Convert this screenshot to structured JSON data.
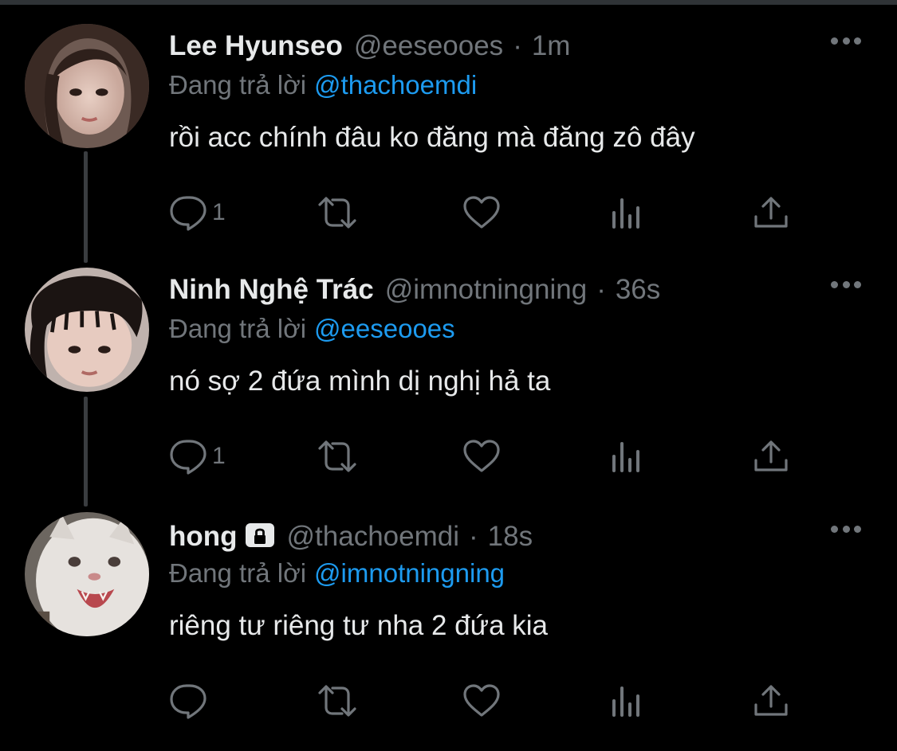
{
  "colors": {
    "background": "#000000",
    "primary_text": "#e7e9ea",
    "secondary_text": "#71767b",
    "mention": "#1d9bf0",
    "thread_line": "#3a3d40"
  },
  "tweets": [
    {
      "display_name": "Lee Hyunseo",
      "protected": false,
      "handle": "@eeseooes",
      "separator": "·",
      "time": "1m",
      "replying_label": "Đang trả lời",
      "replying_to": "@thachoemdi",
      "text": "rồi acc chính đâu ko đăng mà đăng zô đây",
      "reply_count": "1",
      "icons": [
        "reply-icon",
        "retweet-icon",
        "like-icon",
        "views-icon",
        "share-icon",
        "more-icon"
      ]
    },
    {
      "display_name": "Ninh Nghệ Trác",
      "protected": false,
      "handle": "@imnotningning",
      "separator": "·",
      "time": "36s",
      "replying_label": "Đang trả lời",
      "replying_to": "@eeseooes",
      "text": "nó sợ 2 đứa mình dị nghị hả ta",
      "reply_count": "1",
      "icons": [
        "reply-icon",
        "retweet-icon",
        "like-icon",
        "views-icon",
        "share-icon",
        "more-icon"
      ]
    },
    {
      "display_name": "hong",
      "protected": true,
      "handle": "@thachoemdi",
      "separator": "·",
      "time": "18s",
      "replying_label": "Đang trả lời",
      "replying_to": "@imnotningning",
      "text": "riêng tư riêng tư nha 2 đứa kia",
      "reply_count": "",
      "icons": [
        "reply-icon",
        "retweet-icon",
        "like-icon",
        "views-icon",
        "share-icon",
        "more-icon",
        "lock-icon"
      ]
    }
  ]
}
